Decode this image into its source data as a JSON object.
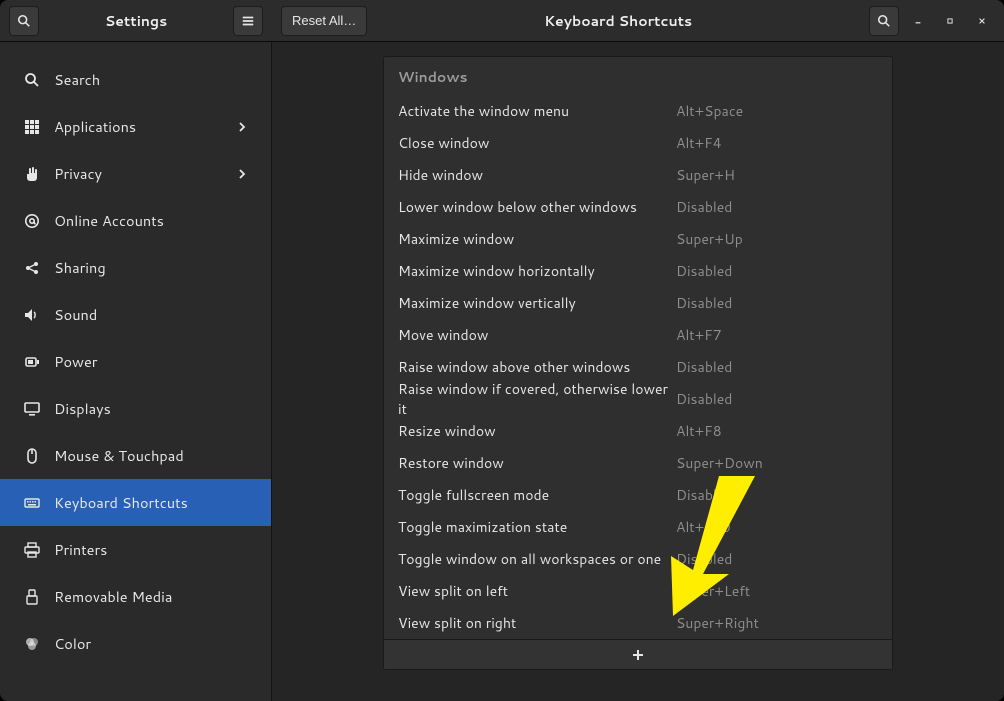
{
  "titlebar": {
    "left_title": "Settings",
    "right_title": "Keyboard Shortcuts",
    "reset_label": "Reset All…"
  },
  "sidebar": {
    "items": [
      {
        "id": "search",
        "label": "Search",
        "icon": "search-icon",
        "chevron": false
      },
      {
        "id": "applications",
        "label": "Applications",
        "icon": "apps-icon",
        "chevron": true
      },
      {
        "id": "privacy",
        "label": "Privacy",
        "icon": "hand-icon",
        "chevron": true
      },
      {
        "id": "online-accounts",
        "label": "Online Accounts",
        "icon": "at-icon",
        "chevron": false
      },
      {
        "id": "sharing",
        "label": "Sharing",
        "icon": "share-icon",
        "chevron": false
      },
      {
        "id": "sound",
        "label": "Sound",
        "icon": "sound-icon",
        "chevron": false
      },
      {
        "id": "power",
        "label": "Power",
        "icon": "power-icon",
        "chevron": false
      },
      {
        "id": "displays",
        "label": "Displays",
        "icon": "display-icon",
        "chevron": false
      },
      {
        "id": "mouse",
        "label": "Mouse & Touchpad",
        "icon": "mouse-icon",
        "chevron": false
      },
      {
        "id": "keyboard",
        "label": "Keyboard Shortcuts",
        "icon": "keyboard-icon",
        "chevron": false,
        "selected": true
      },
      {
        "id": "printers",
        "label": "Printers",
        "icon": "printer-icon",
        "chevron": false
      },
      {
        "id": "removable",
        "label": "Removable Media",
        "icon": "removable-icon",
        "chevron": false
      },
      {
        "id": "color",
        "label": "Color",
        "icon": "color-icon",
        "chevron": false
      }
    ]
  },
  "shortcuts": {
    "section_title": "Windows",
    "rows": [
      {
        "name": "Activate the window menu",
        "accel": "Alt+Space"
      },
      {
        "name": "Close window",
        "accel": "Alt+F4"
      },
      {
        "name": "Hide window",
        "accel": "Super+H"
      },
      {
        "name": "Lower window below other windows",
        "accel": "Disabled"
      },
      {
        "name": "Maximize window",
        "accel": "Super+Up"
      },
      {
        "name": "Maximize window horizontally",
        "accel": "Disabled"
      },
      {
        "name": "Maximize window vertically",
        "accel": "Disabled"
      },
      {
        "name": "Move window",
        "accel": "Alt+F7"
      },
      {
        "name": "Raise window above other windows",
        "accel": "Disabled"
      },
      {
        "name": "Raise window if covered, otherwise lower it",
        "accel": "Disabled"
      },
      {
        "name": "Resize window",
        "accel": "Alt+F8"
      },
      {
        "name": "Restore window",
        "accel": "Super+Down"
      },
      {
        "name": "Toggle fullscreen mode",
        "accel": "Disabled"
      },
      {
        "name": "Toggle maximization state",
        "accel": "Alt+F10"
      },
      {
        "name": "Toggle window on all workspaces or one",
        "accel": "Disabled"
      },
      {
        "name": "View split on left",
        "accel": "Super+Left"
      },
      {
        "name": "View split on right",
        "accel": "Super+Right"
      }
    ]
  }
}
